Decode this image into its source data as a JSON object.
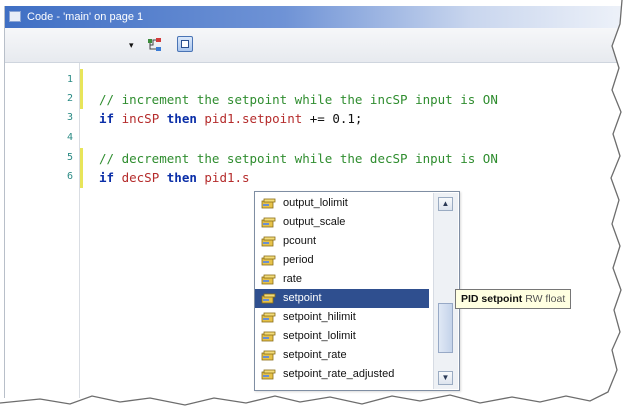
{
  "window": {
    "title": "Code - 'main' on page 1"
  },
  "toolbar": {
    "dropdown_glyph": "▾",
    "tree_icon": "tree-icon",
    "calc_icon": "calculator-icon"
  },
  "editor": {
    "line_numbers": [
      "1",
      "2",
      "3",
      "4",
      "5",
      "6"
    ],
    "lines": [
      {
        "num": "1",
        "parts": []
      },
      {
        "num": "2",
        "parts": [
          [
            "cmt",
            "// increment the setpoint while the incSP input is ON"
          ]
        ]
      },
      {
        "num": "3",
        "parts": [
          [
            "kw",
            "if"
          ],
          [
            "op",
            " "
          ],
          [
            "id",
            "incSP"
          ],
          [
            "op",
            " "
          ],
          [
            "kw",
            "then"
          ],
          [
            "op",
            " "
          ],
          [
            "id",
            "pid1.setpoint"
          ],
          [
            "op",
            " += "
          ],
          [
            "num",
            "0.1;"
          ]
        ]
      },
      {
        "num": "4",
        "parts": []
      },
      {
        "num": "5",
        "parts": [
          [
            "cmt",
            "// decrement the setpoint while the decSP input is ON"
          ]
        ]
      },
      {
        "num": "6",
        "parts": [
          [
            "kw",
            "if"
          ],
          [
            "op",
            " "
          ],
          [
            "id",
            "decSP"
          ],
          [
            "op",
            " "
          ],
          [
            "kw",
            "then"
          ],
          [
            "op",
            " "
          ],
          [
            "id",
            "pid1.s"
          ]
        ]
      }
    ]
  },
  "autocomplete": {
    "items": [
      "output_lolimit",
      "output_scale",
      "pcount",
      "period",
      "rate",
      "setpoint",
      "setpoint_hilimit",
      "setpoint_lolimit",
      "setpoint_rate",
      "setpoint_rate_adjusted"
    ],
    "selected": "setpoint",
    "scroll_up": "▲",
    "scroll_down": "▼"
  },
  "tooltip": {
    "title": "PID setpoint",
    "detail": "RW float"
  },
  "colors": {
    "comment": "#2f8d2f",
    "keyword": "#0b2fa8",
    "identifier": "#b52c2c",
    "selection": "#2f4f8f",
    "tooltip_bg": "#ffffe1"
  }
}
